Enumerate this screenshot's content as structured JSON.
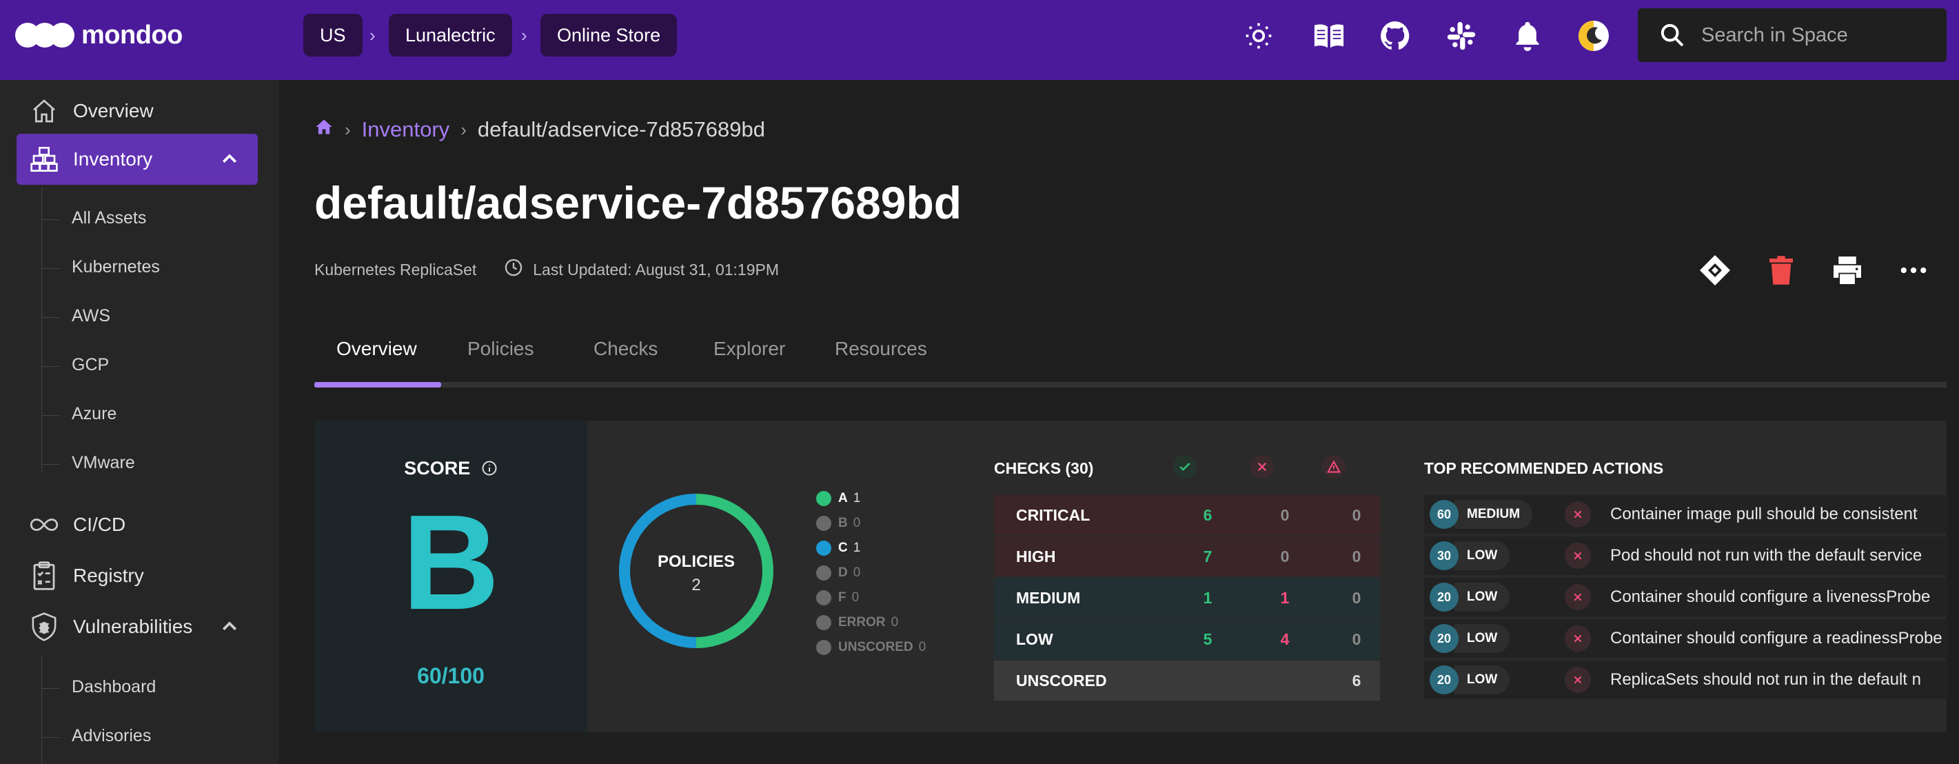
{
  "app": {
    "name": "mondoo"
  },
  "topbar": {
    "breadcrumbs": [
      "US",
      "Lunalectric",
      "Online Store"
    ],
    "icons": [
      "sun-icon",
      "docs-book-icon",
      "github-icon",
      "slack-icon",
      "bell-icon",
      "theme-toggle-icon"
    ],
    "search_placeholder": "Search in Space"
  },
  "sidebar": {
    "items": [
      {
        "label": "Overview",
        "icon": "home-icon"
      },
      {
        "label": "Inventory",
        "icon": "inventory-icon",
        "active": true,
        "expanded": true
      },
      {
        "label": "CI/CD",
        "icon": "infinity-icon"
      },
      {
        "label": "Registry",
        "icon": "clipboard-icon"
      },
      {
        "label": "Vulnerabilities",
        "icon": "bug-shield-icon",
        "expanded": true
      }
    ],
    "inventory_sub": [
      "All Assets",
      "Kubernetes",
      "AWS",
      "GCP",
      "Azure",
      "VMware"
    ],
    "vuln_sub": [
      "Dashboard",
      "Advisories"
    ]
  },
  "page": {
    "breadcrumb": {
      "link": "Inventory",
      "current": "default/adservice-7d857689bd"
    },
    "title": "default/adservice-7d857689bd",
    "asset_type": "Kubernetes ReplicaSet",
    "last_updated": "Last Updated: August 31, 01:19PM",
    "tabs": [
      "Overview",
      "Policies",
      "Checks",
      "Explorer",
      "Resources"
    ],
    "active_tab": "Overview"
  },
  "score": {
    "label": "SCORE",
    "grade": "B",
    "value": "60/100",
    "color": "#2bc2c8"
  },
  "policies": {
    "label": "POLICIES",
    "count": "2",
    "legend": [
      {
        "grade": "A",
        "count": "1",
        "color": "#2fc27a",
        "active": true
      },
      {
        "grade": "B",
        "count": "0",
        "color": "#6a6a6a",
        "active": false
      },
      {
        "grade": "C",
        "count": "1",
        "color": "#1c9ad6",
        "active": true
      },
      {
        "grade": "D",
        "count": "0",
        "color": "#6a6a6a",
        "active": false
      },
      {
        "grade": "F",
        "count": "0",
        "color": "#6a6a6a",
        "active": false
      },
      {
        "grade": "ERROR",
        "count": "0",
        "color": "#6a6a6a",
        "active": false
      },
      {
        "grade": "UNSCORED",
        "count": "0",
        "color": "#6a6a6a",
        "active": false
      }
    ]
  },
  "checks": {
    "title": "CHECKS (30)",
    "rows": [
      {
        "label": "CRITICAL",
        "pass": "6",
        "fail": "0",
        "error": "0",
        "bg": "#3b2529"
      },
      {
        "label": "HIGH",
        "pass": "7",
        "fail": "0",
        "error": "0",
        "bg": "#3a2529"
      },
      {
        "label": "MEDIUM",
        "pass": "1",
        "fail": "1",
        "error": "0",
        "bg": "#233033"
      },
      {
        "label": "LOW",
        "pass": "5",
        "fail": "4",
        "error": "0",
        "bg": "#233033"
      },
      {
        "label": "UNSCORED",
        "pass": "",
        "fail": "",
        "error": "6",
        "bg": "#3a3a3a"
      }
    ]
  },
  "top_actions": {
    "title": "TOP RECOMMENDED ACTIONS",
    "items": [
      {
        "score": "60",
        "severity": "MEDIUM",
        "text": "Container image pull should be consistent"
      },
      {
        "score": "30",
        "severity": "LOW",
        "text": "Pod should not run with the default service"
      },
      {
        "score": "20",
        "severity": "LOW",
        "text": "Container should configure a livenessProbe"
      },
      {
        "score": "20",
        "severity": "LOW",
        "text": "Container should configure a readinessProbe"
      },
      {
        "score": "20",
        "severity": "LOW",
        "text": "ReplicaSets should not run in the default n"
      }
    ]
  },
  "page_actions": [
    "jira-icon",
    "delete-icon",
    "print-icon",
    "more-icon"
  ]
}
